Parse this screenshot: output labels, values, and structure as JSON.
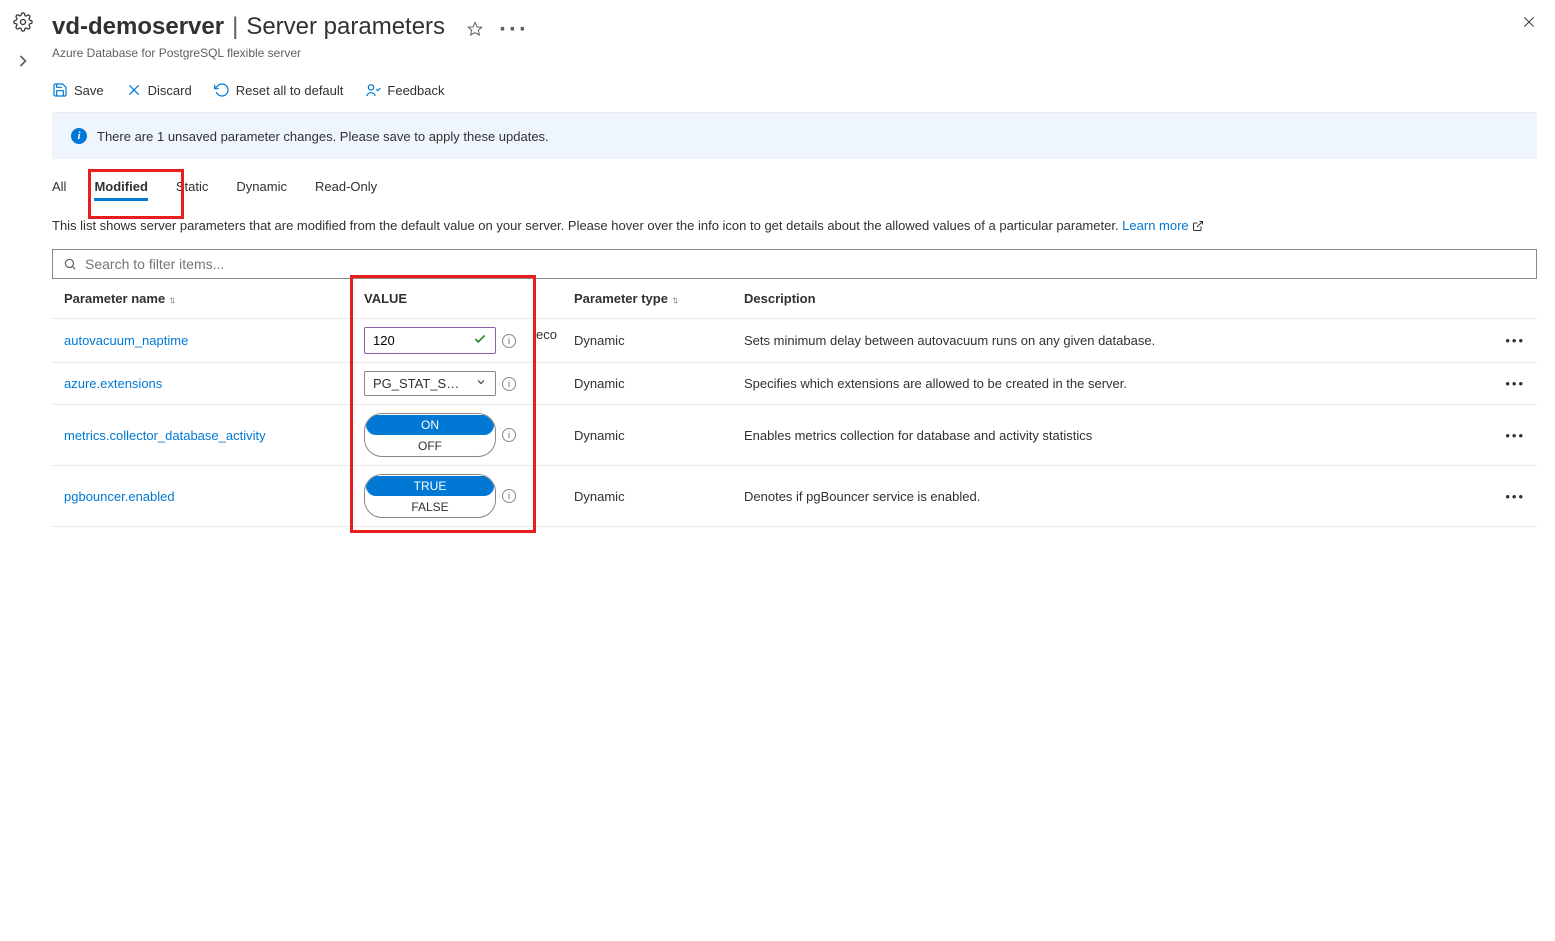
{
  "header": {
    "resource_name": "vd-demoserver",
    "page_title": "Server parameters",
    "subtitle": "Azure Database for PostgreSQL flexible server"
  },
  "toolbar": {
    "save": "Save",
    "discard": "Discard",
    "reset": "Reset all to default",
    "feedback": "Feedback"
  },
  "banner": {
    "text": "There are 1 unsaved parameter changes.  Please save to apply these updates."
  },
  "tabs": {
    "all": "All",
    "modified": "Modified",
    "static": "Static",
    "dynamic": "Dynamic",
    "readonly": "Read-Only"
  },
  "tabdesc": {
    "text": "This list shows server parameters that are modified from the default value on your server. Please hover over the info icon to get details about the allowed values of a particular parameter. ",
    "learn": "Learn more"
  },
  "search": {
    "placeholder": "Search to filter items..."
  },
  "columns": {
    "name": "Parameter name",
    "value": "VALUE",
    "type": "Parameter type",
    "desc": "Description"
  },
  "trunc_overlay": "eco",
  "rows": [
    {
      "name": "autovacuum_naptime",
      "value_kind": "text",
      "value": "120",
      "type": "Dynamic",
      "desc": "Sets minimum delay between autovacuum runs on any given database."
    },
    {
      "name": "azure.extensions",
      "value_kind": "select",
      "value": "PG_STAT_S…",
      "type": "Dynamic",
      "desc": "Specifies which extensions are allowed to be created in the server."
    },
    {
      "name": "metrics.collector_database_activity",
      "value_kind": "toggle",
      "value_on": "ON",
      "value_off": "OFF",
      "type": "Dynamic",
      "desc": "Enables metrics collection for database and activity statistics"
    },
    {
      "name": "pgbouncer.enabled",
      "value_kind": "toggle",
      "value_on": "TRUE",
      "value_off": "FALSE",
      "type": "Dynamic",
      "desc": "Denotes if pgBouncer service is enabled."
    }
  ]
}
